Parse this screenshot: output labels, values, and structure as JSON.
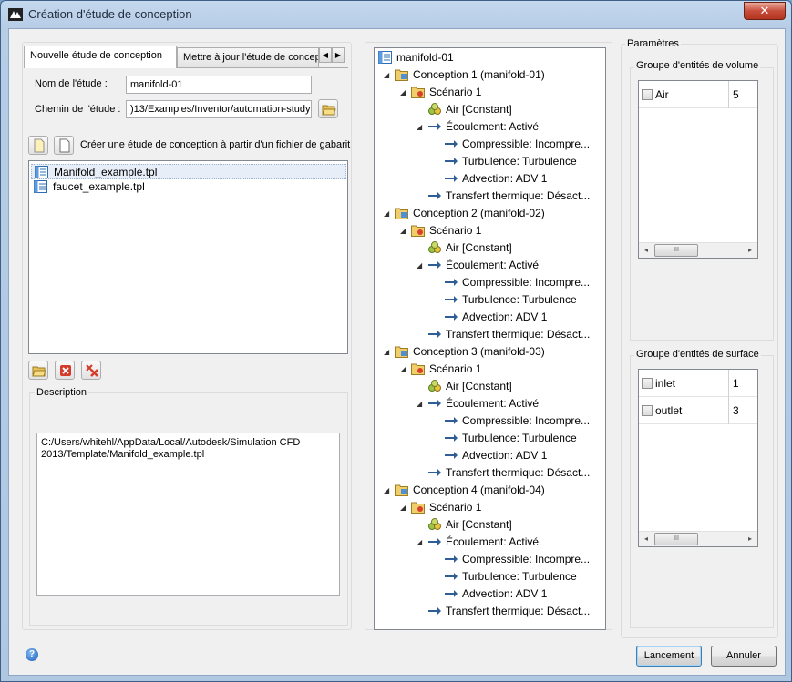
{
  "window": {
    "title": "Création d'étude de conception",
    "close_label": "✕"
  },
  "tabs": [
    {
      "label": "Nouvelle étude de conception"
    },
    {
      "label": "Mettre à jour l'étude de conception"
    }
  ],
  "form": {
    "name_label": "Nom de l'étude :",
    "name_value": "manifold-01",
    "path_label": "Chemin de l'étude :",
    "path_value": ")13/Examples/Inventor/automation-study",
    "template_label": "Créer une étude de conception à partir d'un fichier de gabarit"
  },
  "files": [
    {
      "name": "Manifold_example.tpl"
    },
    {
      "name": "faucet_example.tpl"
    }
  ],
  "description": {
    "title": "Description",
    "line1": "C:/Users/whitehl/AppData/Local/Autodesk/Simulation CFD",
    "line2": "2013/Template/Manifold_example.tpl"
  },
  "tree": {
    "root": "manifold-01",
    "nodes": [
      "Conception 1 (manifold-01)",
      "Scénario 1",
      "Air [Constant]",
      "Écoulement: Activé",
      "Compressible: Incompre...",
      "Turbulence: Turbulence",
      "Advection: ADV 1",
      "Transfert thermique: Désact...",
      "Conception 2 (manifold-02)",
      "Scénario 1",
      "Air [Constant]",
      "Écoulement: Activé",
      "Compressible: Incompre...",
      "Turbulence: Turbulence",
      "Advection: ADV 1",
      "Transfert thermique: Désact...",
      "Conception 3 (manifold-03)",
      "Scénario 1",
      "Air [Constant]",
      "Écoulement: Activé",
      "Compressible: Incompre...",
      "Turbulence: Turbulence",
      "Advection: ADV 1",
      "Transfert thermique: Désact...",
      "Conception 4 (manifold-04)",
      "Scénario 1",
      "Air [Constant]",
      "Écoulement: Activé",
      "Compressible: Incompre...",
      "Turbulence: Turbulence",
      "Advection: ADV 1",
      "Transfert thermique: Désact..."
    ]
  },
  "params": {
    "title": "Paramètres",
    "volume_title": "Groupe d'entités de volume",
    "volume": [
      {
        "name": "Air",
        "value": "5"
      }
    ],
    "surface_title": "Groupe d'entités de surface",
    "surface": [
      {
        "name": "inlet",
        "value": "1"
      },
      {
        "name": "outlet",
        "value": "3"
      }
    ],
    "scroll_left": "◂",
    "scroll_right": "▸",
    "thumb": "III"
  },
  "buttons": {
    "launch": "Lancement",
    "cancel": "Annuler",
    "help": "?"
  }
}
